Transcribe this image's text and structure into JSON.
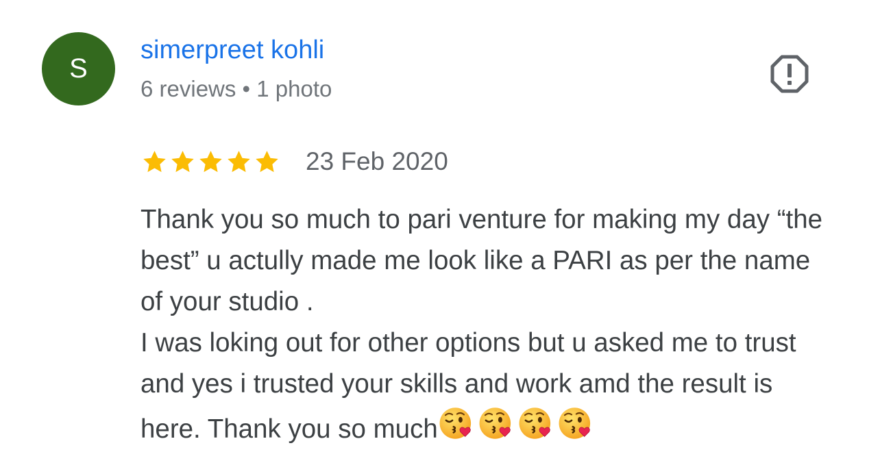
{
  "review": {
    "avatar_letter": "S",
    "avatar_color": "#33691e",
    "author_name": "simerpreet kohli",
    "author_meta": "6 reviews • 1 photo",
    "report_icon": "report-flag-icon",
    "rating": 5,
    "rating_max": 5,
    "star_color": "#fbbc04",
    "date": "23 Feb 2020",
    "text": "Thank you so much to pari venture for making my day “the best” u actully made me look like a PARI as per the name of your studio .\nI was loking out for other options but u asked me to trust and yes i trusted your skills and work amd the result is here. Thank you so much",
    "emoji_name": "face-blowing-a-kiss-icon",
    "emoji_count": 4
  }
}
